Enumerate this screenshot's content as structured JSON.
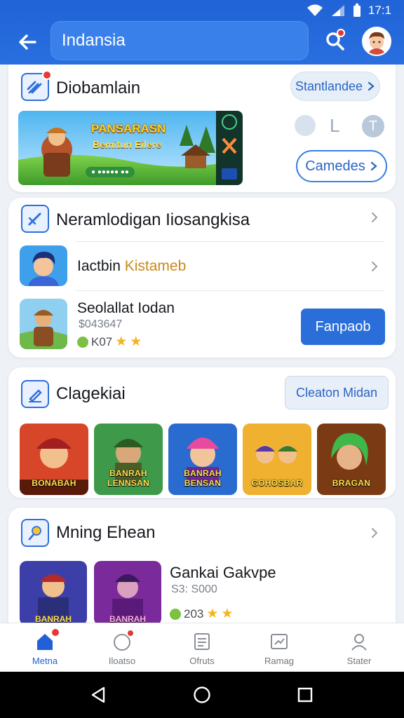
{
  "status_bar": {
    "time": "17:1"
  },
  "app_bar": {
    "search_value": "Indansia"
  },
  "promo": {
    "title": "Diobamlain",
    "pill_label": "Stantlandee",
    "banner_title": "PANSARASN",
    "banner_subtitle": "Bemitun Eilere",
    "banner_tag": "● ●●●●● ●●",
    "games_button": "Camedes"
  },
  "list_card": {
    "header_title": "Neramlodigan Iiosangkisa",
    "rows": [
      {
        "title": "Iactbin",
        "highlight": "Kistameb"
      },
      {
        "title": "Seolallat Iodan",
        "meta": "$043647",
        "rating": "K07",
        "button": "Fanpaob"
      }
    ]
  },
  "category": {
    "title": "Clagekiai",
    "button": "Cleaton Midan",
    "games": [
      {
        "label": "BONABAH"
      },
      {
        "label": "BANRAH LENNSAN"
      },
      {
        "label": "BANRAH BENSAN"
      },
      {
        "label": "GOHOSBAR"
      },
      {
        "label": "BRAGAN"
      }
    ]
  },
  "mining": {
    "title": "Mning Ehean",
    "featured_title": "Gankai Gakvpe",
    "featured_meta": "S3: S000",
    "featured_rating": "203",
    "thumb1_label": "BANRAH",
    "thumb2_label": "BANRAH"
  },
  "bottom_nav": [
    {
      "label": "Metna"
    },
    {
      "label": "Iloatso"
    },
    {
      "label": "Ofruts"
    },
    {
      "label": "Ramag"
    },
    {
      "label": "Stater"
    }
  ],
  "colors": {
    "primary": "#2a6fd9",
    "badge": "#e53935",
    "star": "#f2b51c"
  }
}
